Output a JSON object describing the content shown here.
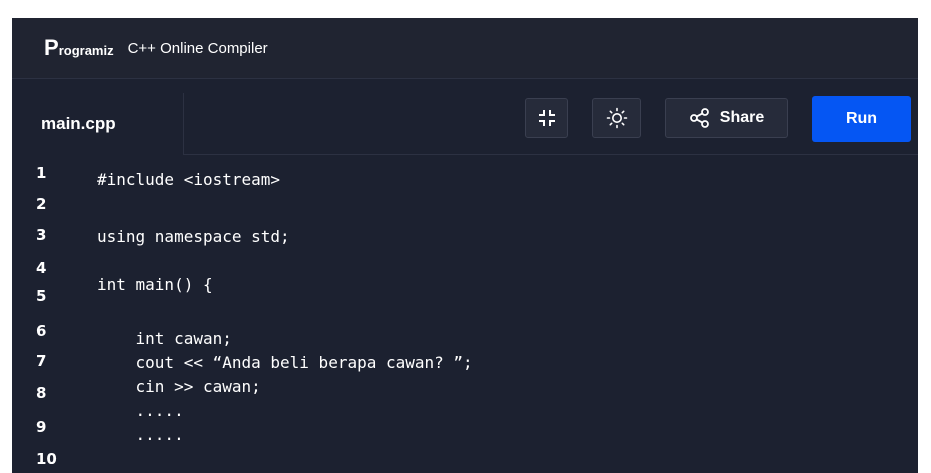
{
  "header": {
    "logo_mark": "P",
    "logo_rest": "rogramiz",
    "title": "C++ Online Compiler"
  },
  "toolbar": {
    "file_tab": "main.cpp",
    "share_label": "Share",
    "run_label": "Run"
  },
  "editor": {
    "line_numbers": [
      "1",
      "2",
      "3",
      "4",
      "5",
      "6",
      "7",
      "8",
      "9",
      "10"
    ],
    "lines": [
      "#include <iostream>",
      "",
      "using namespace std;",
      "",
      "int main() {",
      "",
      "    int cawan;",
      "    cout << “Anda beli berapa cawan? ”;",
      "    cin >> cawan;",
      "    .....",
      "    ....."
    ]
  },
  "colors": {
    "background": "#1c2130",
    "header": "#202431",
    "run_button": "#0556f3",
    "text": "#ffffff"
  },
  "icons": [
    "collapse-icon",
    "sun-icon",
    "share-icon"
  ]
}
